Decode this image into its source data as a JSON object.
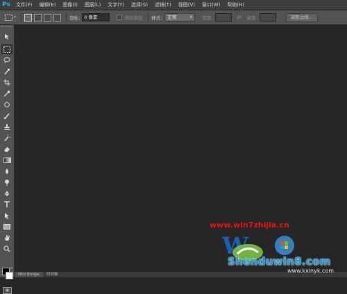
{
  "app": {
    "logo": "Ps",
    "accent": "#2fa3e6"
  },
  "menubar": {
    "items": [
      "文件(F)",
      "编辑(E)",
      "图像(I)",
      "图层(L)",
      "文字(Y)",
      "选择(S)",
      "滤镜(T)",
      "视图(V)",
      "窗口(W)",
      "帮助(H)"
    ]
  },
  "options": {
    "tool_icon": "rect-marquee-icon",
    "selection_modes": [
      "new-selection",
      "add-to-selection",
      "subtract-from-selection",
      "intersect-selection"
    ],
    "feather_label": "羽化:",
    "feather_value": "0 像素",
    "antialias_label": "消除锯齿",
    "style_label": "样式:",
    "style_value": "正常",
    "width_label": "宽度:",
    "height_label": "高度:",
    "refine_edge_label": "调整边缘..."
  },
  "tools": [
    "move-icon",
    "rect-marquee-icon",
    "lasso-icon",
    "quick-selection-icon",
    "crop-icon",
    "eyedropper-icon",
    "spot-healing-icon",
    "brush-icon",
    "clone-stamp-icon",
    "history-brush-icon",
    "eraser-icon",
    "gradient-icon",
    "blur-icon",
    "dodge-icon",
    "pen-icon",
    "type-icon",
    "path-selection-icon",
    "rectangle-shape-icon",
    "hand-icon",
    "zoom-icon"
  ],
  "swatches": {
    "foreground": "#000000",
    "background": "#ffffff"
  },
  "bottom_tabs": [
    "Mini Bridge",
    "时间轴"
  ],
  "watermark": {
    "line1": "www.win7zhijia.cn",
    "line2": "Shenduwin8.com",
    "line3": "www.kxinyk.com"
  }
}
